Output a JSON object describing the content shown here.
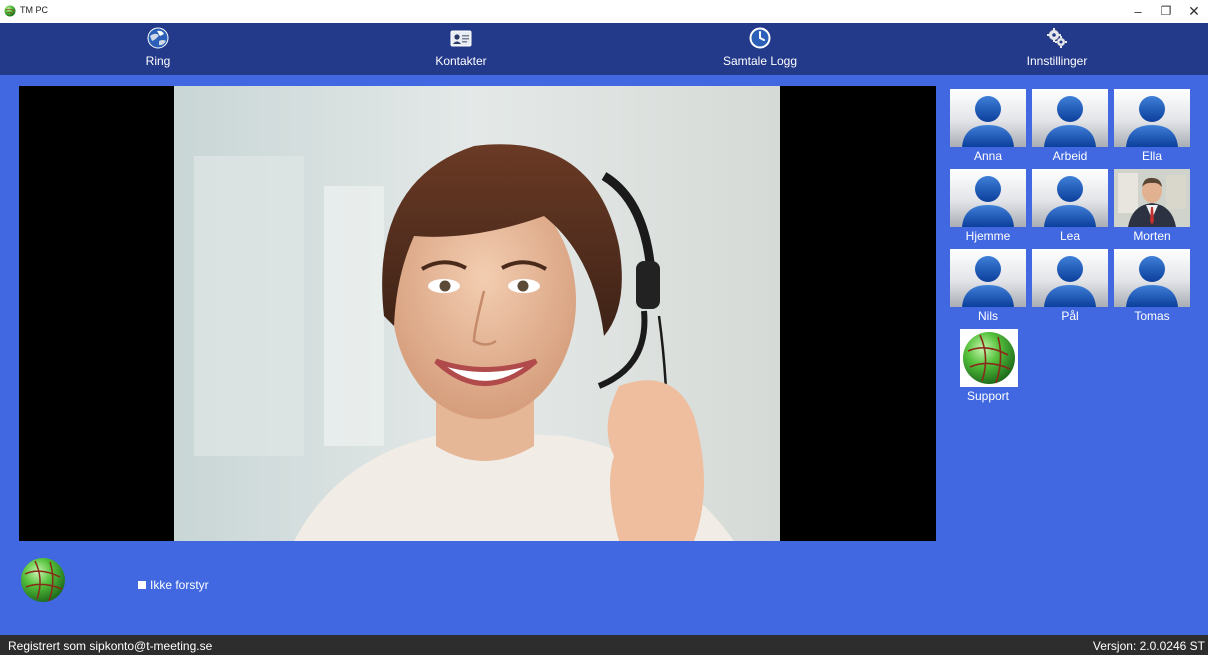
{
  "window": {
    "title": "TM PC",
    "minimize_glyph": "–",
    "maximize_glyph": "❐",
    "close_glyph": "✕"
  },
  "toolbar": {
    "items": [
      {
        "label": "Ring",
        "icon": "globe-phone-icon"
      },
      {
        "label": "Kontakter",
        "icon": "contact-card-icon"
      },
      {
        "label": "Samtale Logg",
        "icon": "clock-icon"
      },
      {
        "label": "Innstillinger",
        "icon": "gears-icon"
      }
    ]
  },
  "video": {
    "description_icon": "video-feed-person-with-headset"
  },
  "contacts": [
    {
      "name": "Anna",
      "icon": "person-silhouette-icon"
    },
    {
      "name": "Arbeid",
      "icon": "person-silhouette-icon"
    },
    {
      "name": "Ella",
      "icon": "person-silhouette-icon"
    },
    {
      "name": "Hjemme",
      "icon": "person-silhouette-icon"
    },
    {
      "name": "Lea",
      "icon": "person-silhouette-icon"
    },
    {
      "name": "Morten",
      "icon": "person-photo-icon"
    },
    {
      "name": "Nils",
      "icon": "person-silhouette-icon"
    },
    {
      "name": "Pål",
      "icon": "person-silhouette-icon"
    },
    {
      "name": "Tomas",
      "icon": "person-silhouette-icon"
    },
    {
      "name": "Support",
      "icon": "green-globe-icon"
    }
  ],
  "do_not_disturb": {
    "label": "Ikke forstyr"
  },
  "status": {
    "registered": "Registrert som sipkonto@t-meeting.se",
    "version": "Versjon: 2.0.0246 ST"
  },
  "colors": {
    "toolbar": "#23398a",
    "background": "#4168e0",
    "statusbar": "#2d2d2d"
  }
}
